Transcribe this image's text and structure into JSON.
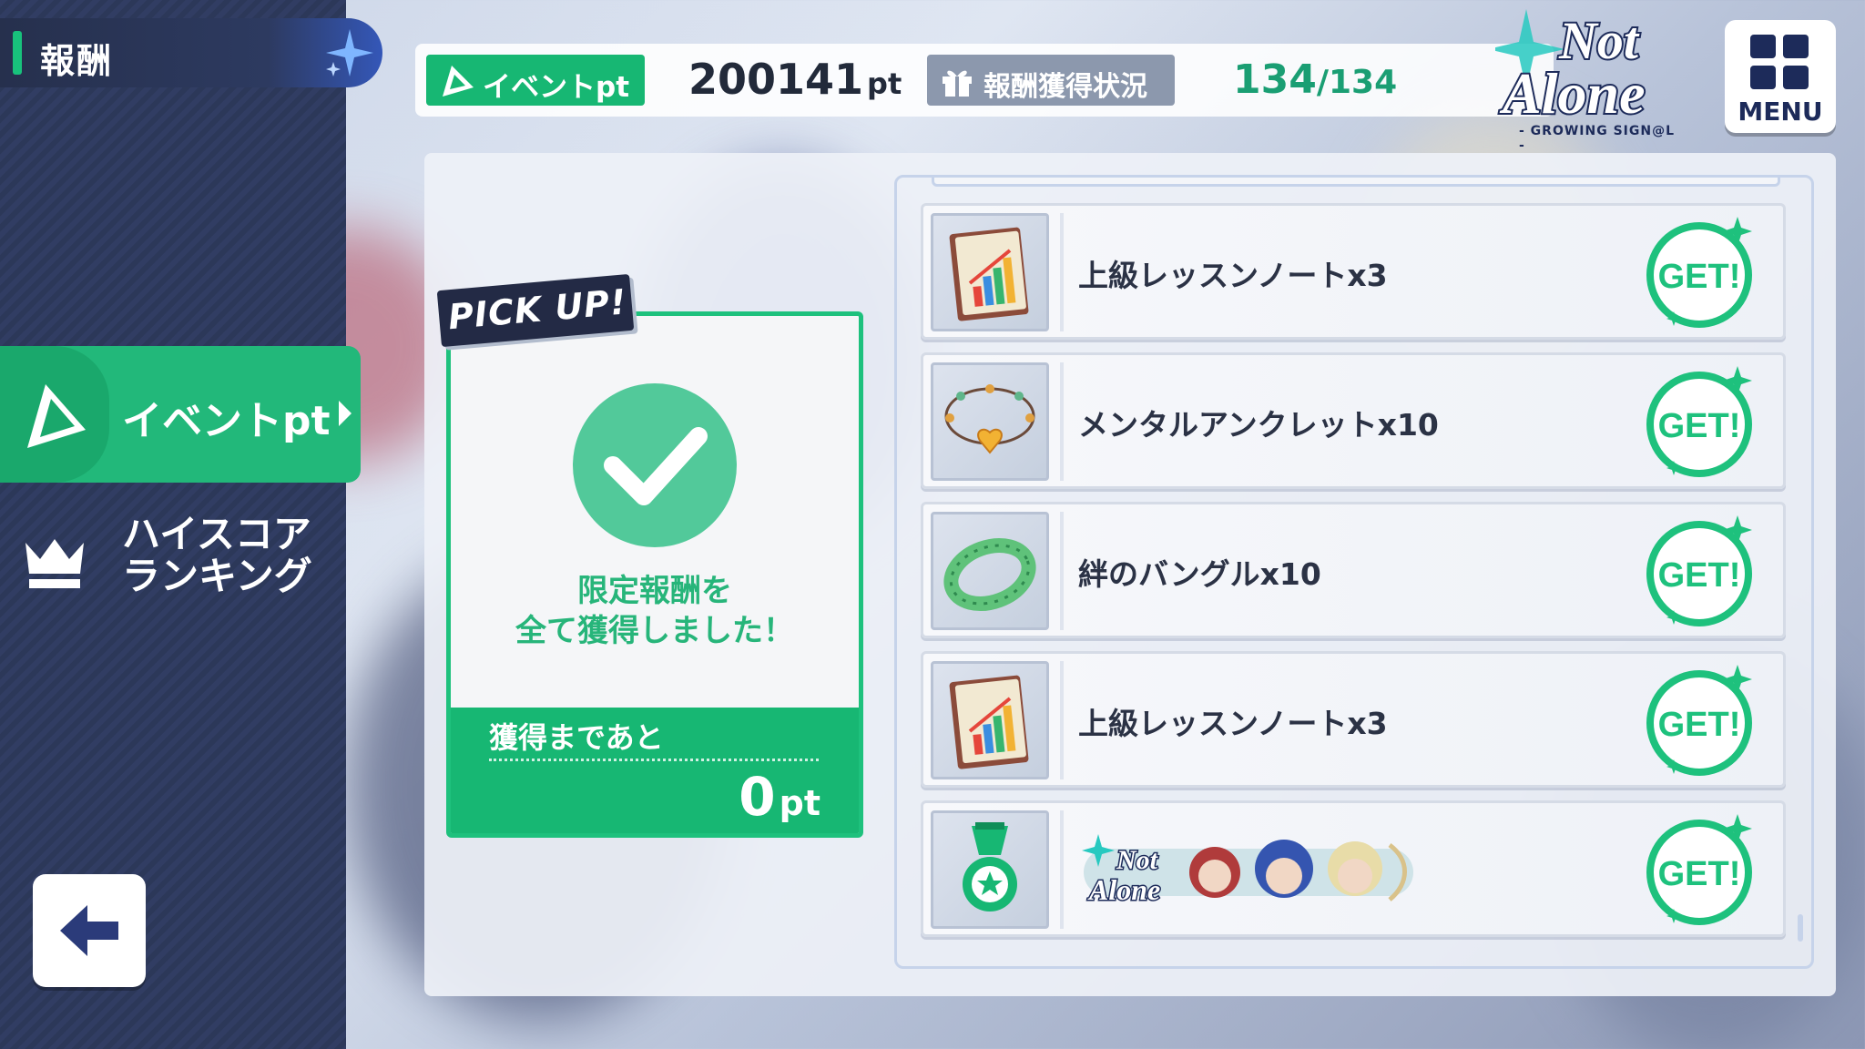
{
  "sidebar": {
    "title": "報酬",
    "nav": [
      {
        "label": "イベントpt",
        "active": true
      },
      {
        "label": "ハイスコア\nランキング",
        "active": false
      }
    ]
  },
  "header": {
    "event_pt_label": "イベントpt",
    "event_pt_value": "200141",
    "event_pt_unit": "pt",
    "reward_status_label": "報酬獲得状況",
    "reward_count": "134",
    "reward_total": "/134"
  },
  "logo": {
    "line1": "Not",
    "line2": "Alone",
    "sub": "- GROWING SIGN@L -"
  },
  "menu": {
    "label": "MENU"
  },
  "pickup": {
    "tag": "PICK UP!",
    "message_line1": "限定報酬を",
    "message_line2": "全て獲得しました！",
    "remaining_label": "獲得まであと",
    "remaining_value": "0",
    "remaining_unit": "pt"
  },
  "rewards": [
    {
      "name": "上級レッスンノートx3",
      "icon": "lesson-note-icon",
      "get_label": "GET!"
    },
    {
      "name": "メンタルアンクレットx10",
      "icon": "anklet-icon",
      "get_label": "GET!"
    },
    {
      "name": "絆のバングルx10",
      "icon": "bangle-icon",
      "get_label": "GET!"
    },
    {
      "name": "上級レッスンノートx3",
      "icon": "lesson-note-icon",
      "get_label": "GET!"
    },
    {
      "name": "",
      "icon": "medal-icon",
      "banner_line1": "Not",
      "banner_line2": "Alone",
      "get_label": "GET!"
    }
  ],
  "colors": {
    "accent_green": "#17b773",
    "sidebar_bg": "#313d63",
    "dark_navy": "#232a45"
  }
}
